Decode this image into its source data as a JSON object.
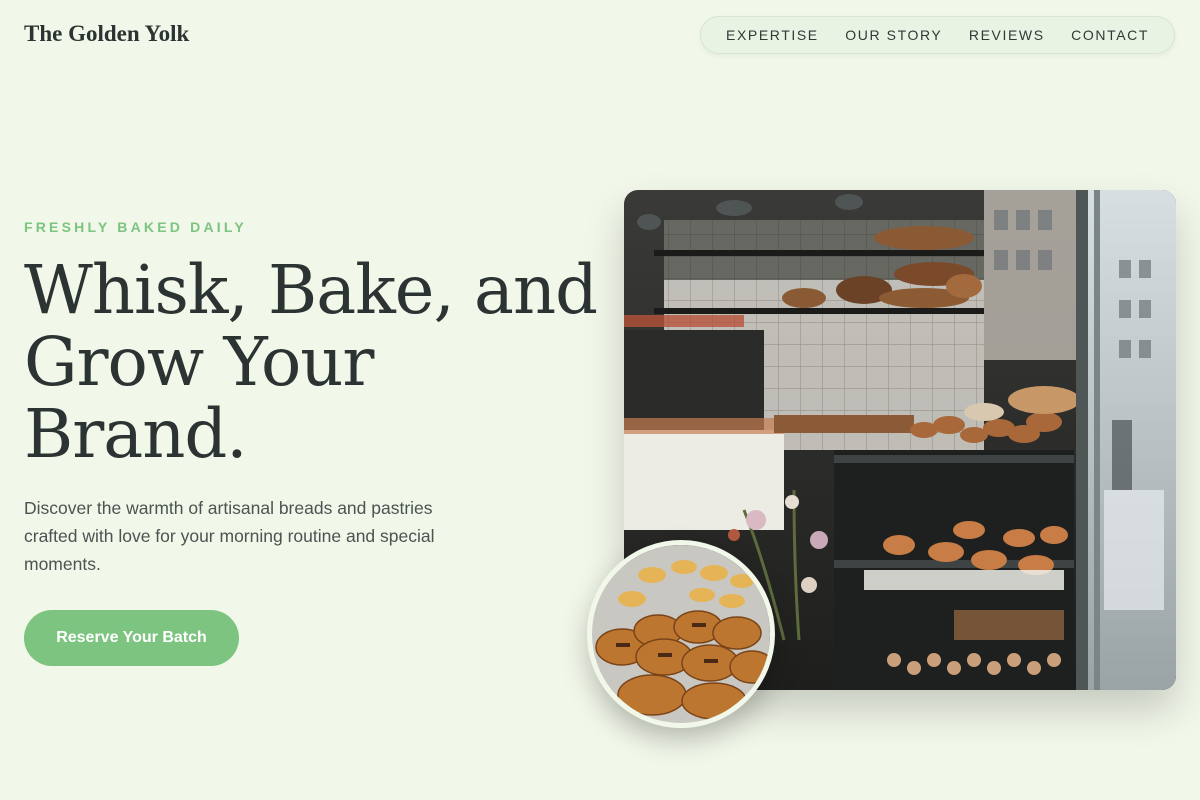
{
  "brand": {
    "name": "The Golden Yolk"
  },
  "nav": {
    "items": [
      {
        "label": "EXPERTISE"
      },
      {
        "label": "OUR STORY"
      },
      {
        "label": "REVIEWS"
      },
      {
        "label": "CONTACT"
      }
    ]
  },
  "hero": {
    "eyebrow": "FRESHLY BAKED DAILY",
    "headline_line1": "Whisk, Bake, and",
    "headline_line2": "Grow Your",
    "headline_line3": "Brand.",
    "description": "Discover the warmth of artisanal breads and pastries crafted with love for your morning routine and special moments.",
    "cta_label": "Reserve Your Batch"
  },
  "colors": {
    "background": "#f1f7e9",
    "accent": "#7cc47f",
    "text": "#2b3432"
  }
}
